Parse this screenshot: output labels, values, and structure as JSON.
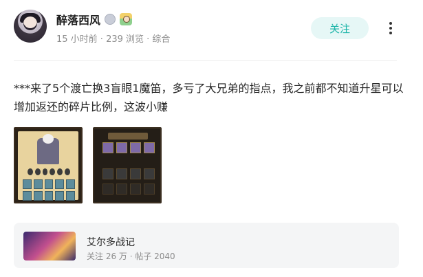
{
  "author": {
    "name": "醉落西风",
    "meta": "15 小时前 · 239 浏览 · 综合"
  },
  "actions": {
    "follow_label": "关注"
  },
  "post": {
    "text": "***来了5个渡亡换3盲眼1魔笛，多亏了大兄弟的指点，我之前都不知道升星可以增加返还的碎片比例，这波小赚",
    "images": [
      "screenshot-star-upgrade",
      "screenshot-collection"
    ]
  },
  "forum": {
    "name": "艾尔多战记",
    "stats": "关注 26 万 · 帖子 2040"
  },
  "colors": {
    "accent": "#1bb4a8",
    "follow_bg": "#e6f7f6",
    "card_bg": "#f4f5f6"
  }
}
